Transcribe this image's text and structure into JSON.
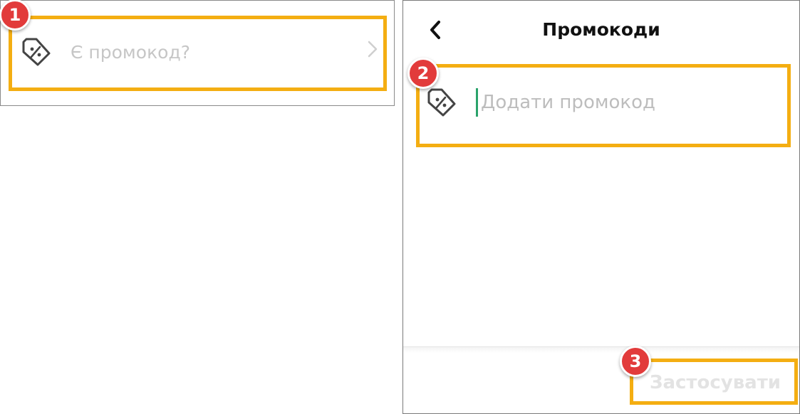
{
  "left_panel": {
    "promo_row": {
      "icon": "percent-tag-icon",
      "label": "Є промокод?",
      "chevron": "chevron-right-icon"
    },
    "marker": "1"
  },
  "right_panel": {
    "header": {
      "back_icon": "chevron-left-icon",
      "title": "Промокоди"
    },
    "promo_input": {
      "icon": "percent-tag-icon",
      "placeholder": "Додати промокод",
      "value": ""
    },
    "marker_input": "2",
    "footer": {
      "apply_label": "Застосувати"
    },
    "marker_apply": "3"
  },
  "colors": {
    "highlight": "#f4ae12",
    "marker": "#e23b3b",
    "cursor": "#2aa36b",
    "placeholder": "#bdbdbd"
  }
}
